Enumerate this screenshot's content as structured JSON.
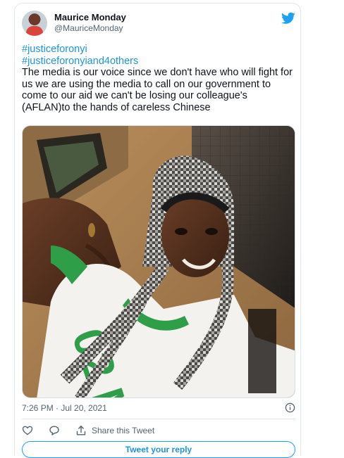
{
  "author": {
    "display_name": "Maurice Monday",
    "handle": "@MauriceMonday"
  },
  "tweet": {
    "hashtags": [
      "#justiceforonyi",
      "#justiceforonyiand4others"
    ],
    "text": "The media is our voice since we don't have who will fight for us we are using the media to call on our government to come to our aid we can't be losing our colleague's (AFLAN)to the hands of careless Chinese",
    "timestamp": "7:26 PM · Jul 20, 2021"
  },
  "photo": {
    "shirt_text": "02 M"
  },
  "actions": {
    "share_label": "Share this Tweet",
    "reply_button_label": "Tweet your reply"
  },
  "icons": {
    "brand": "twitter-bird-icon",
    "info": "info-icon",
    "like": "heart-icon",
    "reply": "comment-icon",
    "share": "share-icon"
  },
  "colors": {
    "accent": "#1da1f2",
    "link": "#1b95e0",
    "muted": "#536471"
  }
}
